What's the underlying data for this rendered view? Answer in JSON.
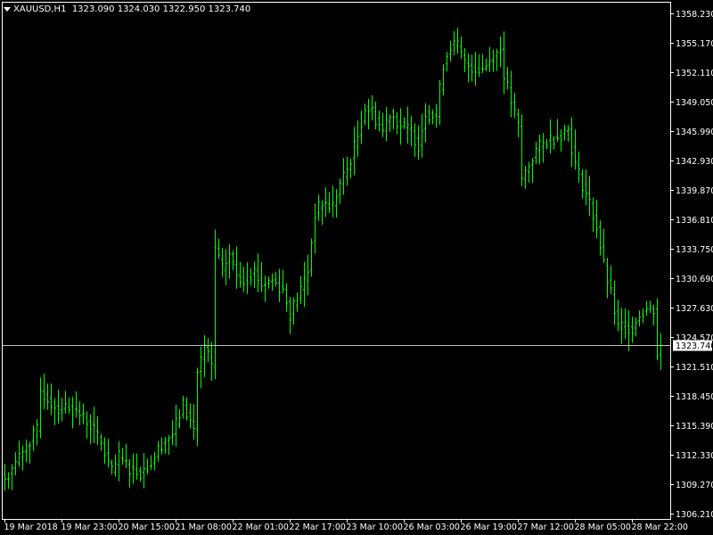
{
  "header": {
    "symbol": "XAUUSD,H1",
    "ohlc": "1323.090 1324.030 1322.950 1323.740"
  },
  "colors": {
    "background": "#000000",
    "bars": "#00ff00",
    "axis": "#ffffff",
    "price_line": "#c0c0c0",
    "price_tag_bg": "#ffffff",
    "price_tag_text": "#000000"
  },
  "chart_data": {
    "type": "ohlc",
    "symbol": "XAUUSD",
    "timeframe": "H1",
    "current_price": 1323.74,
    "current_price_label": "1323.740",
    "ylim": [
      1305.5,
      1359.5
    ],
    "y_ticks": [
      "1358.230",
      "1355.170",
      "1352.110",
      "1349.050",
      "1345.990",
      "1342.930",
      "1339.870",
      "1336.810",
      "1333.750",
      "1330.690",
      "1327.630",
      "1324.570",
      "1321.510",
      "1318.450",
      "1315.390",
      "1312.330",
      "1309.270",
      "1306.210"
    ],
    "x_ticks": [
      {
        "label": "19 Mar 2018",
        "index": 0
      },
      {
        "label": "19 Mar 23:00",
        "index": 16
      },
      {
        "label": "20 Mar 15:00",
        "index": 32
      },
      {
        "label": "21 Mar 08:00",
        "index": 48
      },
      {
        "label": "22 Mar 01:00",
        "index": 64
      },
      {
        "label": "22 Mar 17:00",
        "index": 80
      },
      {
        "label": "23 Mar 10:00",
        "index": 96
      },
      {
        "label": "26 Mar 03:00",
        "index": 112
      },
      {
        "label": "26 Mar 19:00",
        "index": 128
      },
      {
        "label": "27 Mar 12:00",
        "index": 144
      },
      {
        "label": "28 Mar 05:00",
        "index": 160
      },
      {
        "label": "28 Mar 22:00",
        "index": 176
      }
    ],
    "close_path": [
      [
        0,
        1309.8
      ],
      [
        3,
        1311.5
      ],
      [
        6,
        1313.2
      ],
      [
        9,
        1314.8
      ],
      [
        10,
        1318.9
      ],
      [
        12,
        1318.2
      ],
      [
        15,
        1317.0
      ],
      [
        18,
        1317.4
      ],
      [
        21,
        1316.5
      ],
      [
        24,
        1315.5
      ],
      [
        27,
        1313.5
      ],
      [
        30,
        1310.5
      ],
      [
        32,
        1312.0
      ],
      [
        35,
        1311.0
      ],
      [
        38,
        1310.5
      ],
      [
        41,
        1311.5
      ],
      [
        44,
        1313.5
      ],
      [
        47,
        1314.5
      ],
      [
        50,
        1317.5
      ],
      [
        53,
        1315.0
      ],
      [
        54,
        1321.0
      ],
      [
        56,
        1323.5
      ],
      [
        58,
        1321.5
      ],
      [
        59,
        1333.8
      ],
      [
        61,
        1331.5
      ],
      [
        63,
        1333.2
      ],
      [
        65,
        1331.0
      ],
      [
        67,
        1330.5
      ],
      [
        70,
        1331.5
      ],
      [
        72,
        1330.0
      ],
      [
        75,
        1330.5
      ],
      [
        78,
        1329.5
      ],
      [
        80,
        1327.0
      ],
      [
        83,
        1329.5
      ],
      [
        85,
        1331.5
      ],
      [
        87,
        1337.5
      ],
      [
        89,
        1338.5
      ],
      [
        92,
        1338.2
      ],
      [
        94,
        1340.5
      ],
      [
        96,
        1342.0
      ],
      [
        99,
        1345.5
      ],
      [
        101,
        1348.5
      ],
      [
        103,
        1348.0
      ],
      [
        106,
        1346.0
      ],
      [
        108,
        1348.0
      ],
      [
        111,
        1346.5
      ],
      [
        114,
        1346.0
      ],
      [
        116,
        1344.5
      ],
      [
        118,
        1348.0
      ],
      [
        121,
        1347.5
      ],
      [
        123,
        1353.0
      ],
      [
        125,
        1355.0
      ],
      [
        127,
        1354.8
      ],
      [
        129,
        1353.0
      ],
      [
        132,
        1352.5
      ],
      [
        134,
        1352.5
      ],
      [
        137,
        1353.8
      ],
      [
        139,
        1354.5
      ],
      [
        140,
        1352.0
      ],
      [
        142,
        1349.0
      ],
      [
        144,
        1346.5
      ],
      [
        145,
        1341.0
      ],
      [
        147,
        1342.5
      ],
      [
        149,
        1344.0
      ],
      [
        152,
        1345.0
      ],
      [
        155,
        1345.5
      ],
      [
        158,
        1346.2
      ],
      [
        160,
        1342.5
      ],
      [
        162,
        1340.5
      ],
      [
        164,
        1338.5
      ],
      [
        166,
        1336.0
      ],
      [
        168,
        1332.0
      ],
      [
        170,
        1329.0
      ],
      [
        172,
        1325.5
      ],
      [
        174,
        1325.8
      ],
      [
        176,
        1325.5
      ],
      [
        178,
        1327.0
      ],
      [
        180,
        1327.5
      ],
      [
        182,
        1327.5
      ],
      [
        183,
        1322.8
      ],
      [
        184,
        1323.7
      ]
    ]
  }
}
